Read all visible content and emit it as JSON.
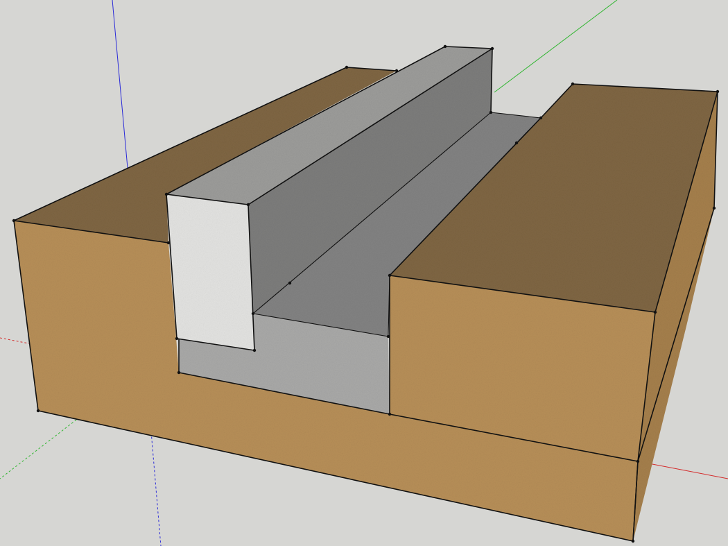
{
  "viewport": {
    "background": "#d6d6d3"
  },
  "materials": {
    "soil_top": "#7f6643",
    "soil_side": "#b78f58",
    "soil_right": "#a57f4c",
    "concrete_light": "#e3e3e1",
    "concrete_top": "#9c9c9a",
    "concrete_side": "#7d7d7c",
    "trench_floor": "#828282",
    "gravel": "#a9a9a8"
  },
  "axes": {
    "red": "#d42a2a",
    "green": "#31b631",
    "blue": "#2a2ad8"
  }
}
